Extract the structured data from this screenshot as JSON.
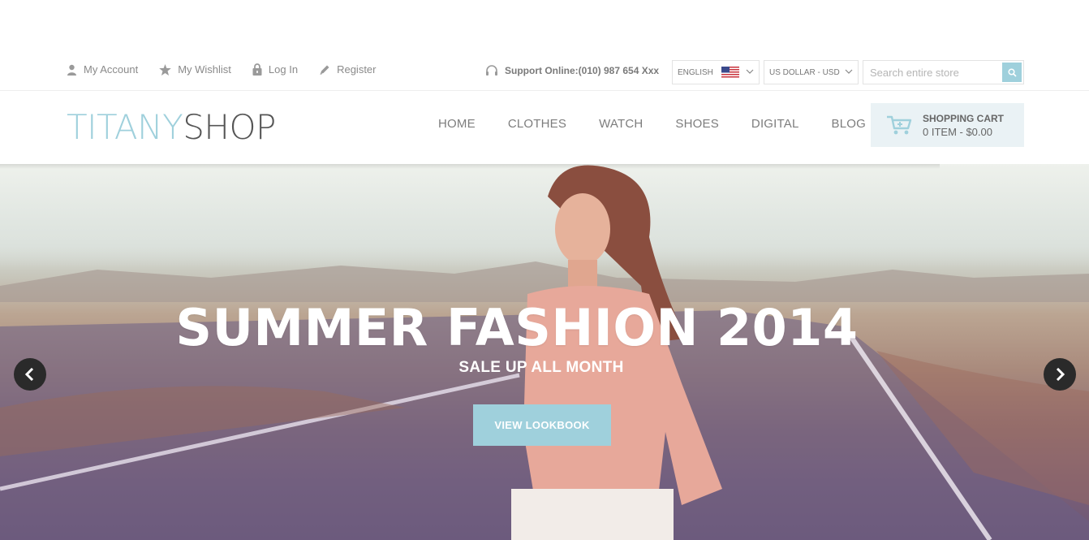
{
  "topbar": {
    "links": [
      {
        "label": "My Account",
        "icon": "user-icon"
      },
      {
        "label": "My Wishlist",
        "icon": "star-icon"
      },
      {
        "label": "Log In",
        "icon": "lock-icon"
      },
      {
        "label": "Register",
        "icon": "pencil-icon"
      }
    ],
    "support_text": "Support Online:(010) 987 654 Xxx",
    "language": {
      "selected": "ENGLISH",
      "flag": "us-flag-icon"
    },
    "currency": {
      "selected": "US DOLLAR - USD"
    },
    "search": {
      "placeholder": "Search entire store",
      "value": ""
    }
  },
  "header": {
    "logo_part1": "TITANY",
    "logo_part2": "SHOP",
    "nav": [
      "HOME",
      "CLOTHES",
      "WATCH",
      "SHOES",
      "DIGITAL",
      "BLOG"
    ],
    "cart": {
      "title": "SHOPPING CART",
      "summary": "0 ITEM - $0.00"
    }
  },
  "hero": {
    "title": "SUMMER FASHION 2014",
    "subtitle": "SALE UP ALL MONTH",
    "button": "VIEW LOOKBOOK"
  },
  "colors": {
    "accent": "#9fd0dc",
    "text": "#7d7d7d",
    "cart_bg": "#eaf2f5"
  }
}
